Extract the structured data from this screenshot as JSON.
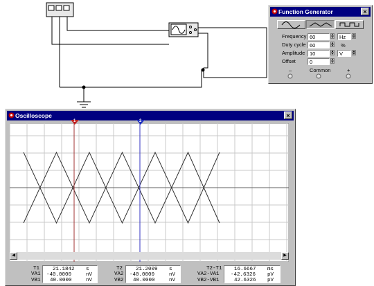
{
  "function_generator": {
    "title": "Function Generator",
    "waveforms": [
      "sine-wave-icon",
      "triangle-wave-icon",
      "square-wave-icon"
    ],
    "selected_waveform": "triangle-wave-icon",
    "frequency": {
      "label": "Frequency",
      "value": "60",
      "unit": "Hz"
    },
    "duty_cycle": {
      "label": "Duty cycle",
      "value": "60",
      "unit": "%"
    },
    "amplitude": {
      "label": "Amplitude",
      "value": "10",
      "unit": "V"
    },
    "offset": {
      "label": "Offset",
      "value": "0"
    },
    "terminals": {
      "minus": "–",
      "common": "Common",
      "plus": "+"
    }
  },
  "oscilloscope": {
    "title": "Oscilloscope",
    "cursor1_label": "1",
    "cursor2_label": "2",
    "readouts": {
      "t1_label": "T1",
      "t1": "21.1842",
      "t1_unit": "s",
      "va1_label": "VA1",
      "va1": "-40.0000",
      "va1_unit": "nV",
      "vb1_label": "VB1",
      "vb1": "40.0000",
      "vb1_unit": "nV",
      "t2_label": "T2",
      "t2": "21.2009",
      "t2_unit": "s",
      "va2_label": "VA2",
      "va2": "-40.0000",
      "va2_unit": "nV",
      "vb2_label": "VB2",
      "vb2": "40.0000",
      "vb2_unit": "nV",
      "dt_label": "T2-T1",
      "dt": "16.6667",
      "dt_unit": "ms",
      "dva_label": "VA2-VA1",
      "dva": "-42.6326",
      "dva_unit": "pV",
      "dvb_label": "VB2-VB1",
      "dvb": "42.6326",
      "dvb_unit": "pV"
    }
  },
  "colors": {
    "title_bar": "#000080",
    "face": "#c0c0c0",
    "cursor1": "#a03030",
    "cursor2": "#3030c0",
    "grid": "#c8c8c8"
  }
}
